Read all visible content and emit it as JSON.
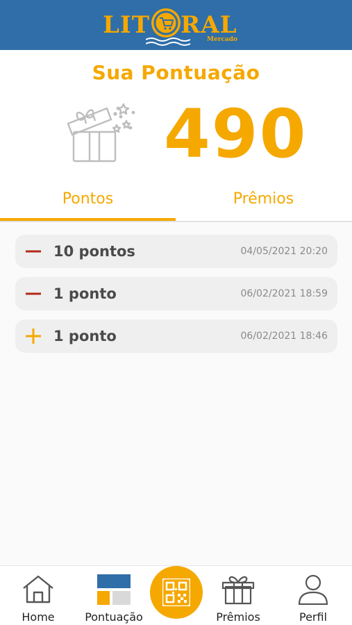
{
  "header": {
    "logo_left": "LIT",
    "logo_right": "RAL",
    "logo_sub": "Mercado",
    "brand_color": "#2f6ea8",
    "accent_color": "#f5a800"
  },
  "score": {
    "title": "Sua Pontuação",
    "value": "490",
    "icon": "gift-open-icon"
  },
  "tabs": [
    {
      "label": "Pontos",
      "active": true
    },
    {
      "label": "Prêmios",
      "active": false
    }
  ],
  "entries": [
    {
      "type": "minus",
      "icon": "minus-icon",
      "points": "10 pontos",
      "date": "04/05/2021 20:20"
    },
    {
      "type": "minus",
      "icon": "minus-icon",
      "points": "1 ponto",
      "date": "06/02/2021 18:59"
    },
    {
      "type": "plus",
      "icon": "plus-icon",
      "points": "1 ponto",
      "date": "06/02/2021 18:46"
    }
  ],
  "nav": {
    "home": "Home",
    "pontuacao": "Pontuação",
    "qr": "qr-code-icon",
    "premios": "Prêmios",
    "perfil": "Perfil"
  }
}
